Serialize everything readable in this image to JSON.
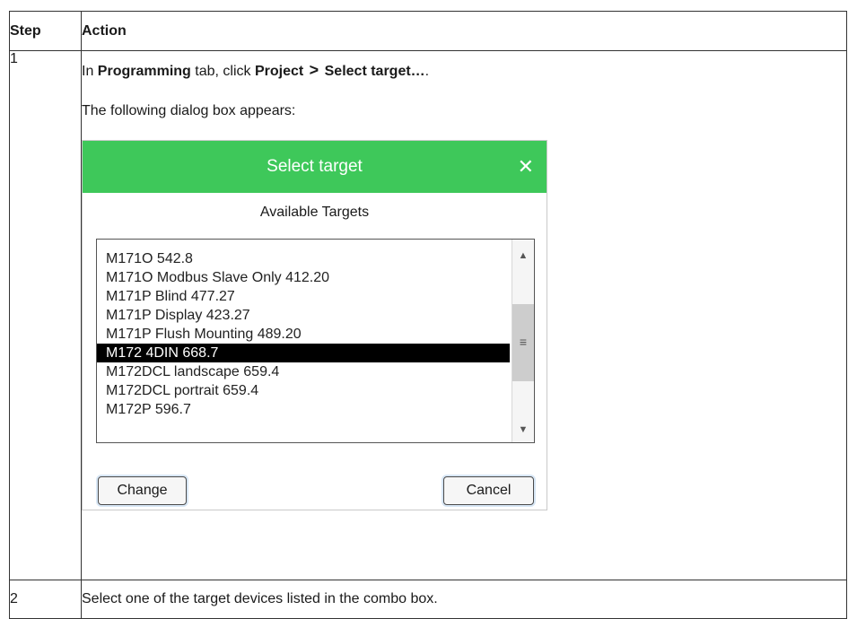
{
  "table": {
    "headers": {
      "step": "Step",
      "action": "Action"
    },
    "rows": [
      {
        "step": "1",
        "instruction": {
          "prefix": "In ",
          "tab": "Programming",
          "middle": " tab, click ",
          "menu": "Project",
          "arrow": ">",
          "item": "Select target…",
          "suffix": "."
        },
        "result_text": "The following dialog box appears:"
      },
      {
        "step": "2",
        "text": "Select one of the target devices listed in the combo box."
      }
    ]
  },
  "dialog": {
    "title": "Select target",
    "close_glyph": "✕",
    "subtitle": "Available Targets",
    "targets": [
      "M171O 542.8",
      "M171O Modbus Slave Only 412.20",
      "M171P Blind 477.27",
      "M171P Display 423.27",
      "M171P Flush Mounting 489.20",
      "M172 4DIN 668.7",
      "M172DCL landscape 659.4",
      "M172DCL portrait 659.4",
      "M172P 596.7"
    ],
    "selected_target": "M172 4DIN 668.7",
    "scroll_up_glyph": "▲",
    "scroll_down_glyph": "▼",
    "scroll_thumb_glyph": "≡",
    "change_label": "Change",
    "cancel_label": "Cancel",
    "accent_color": "#3ec85a",
    "selection_color": "#000000"
  }
}
